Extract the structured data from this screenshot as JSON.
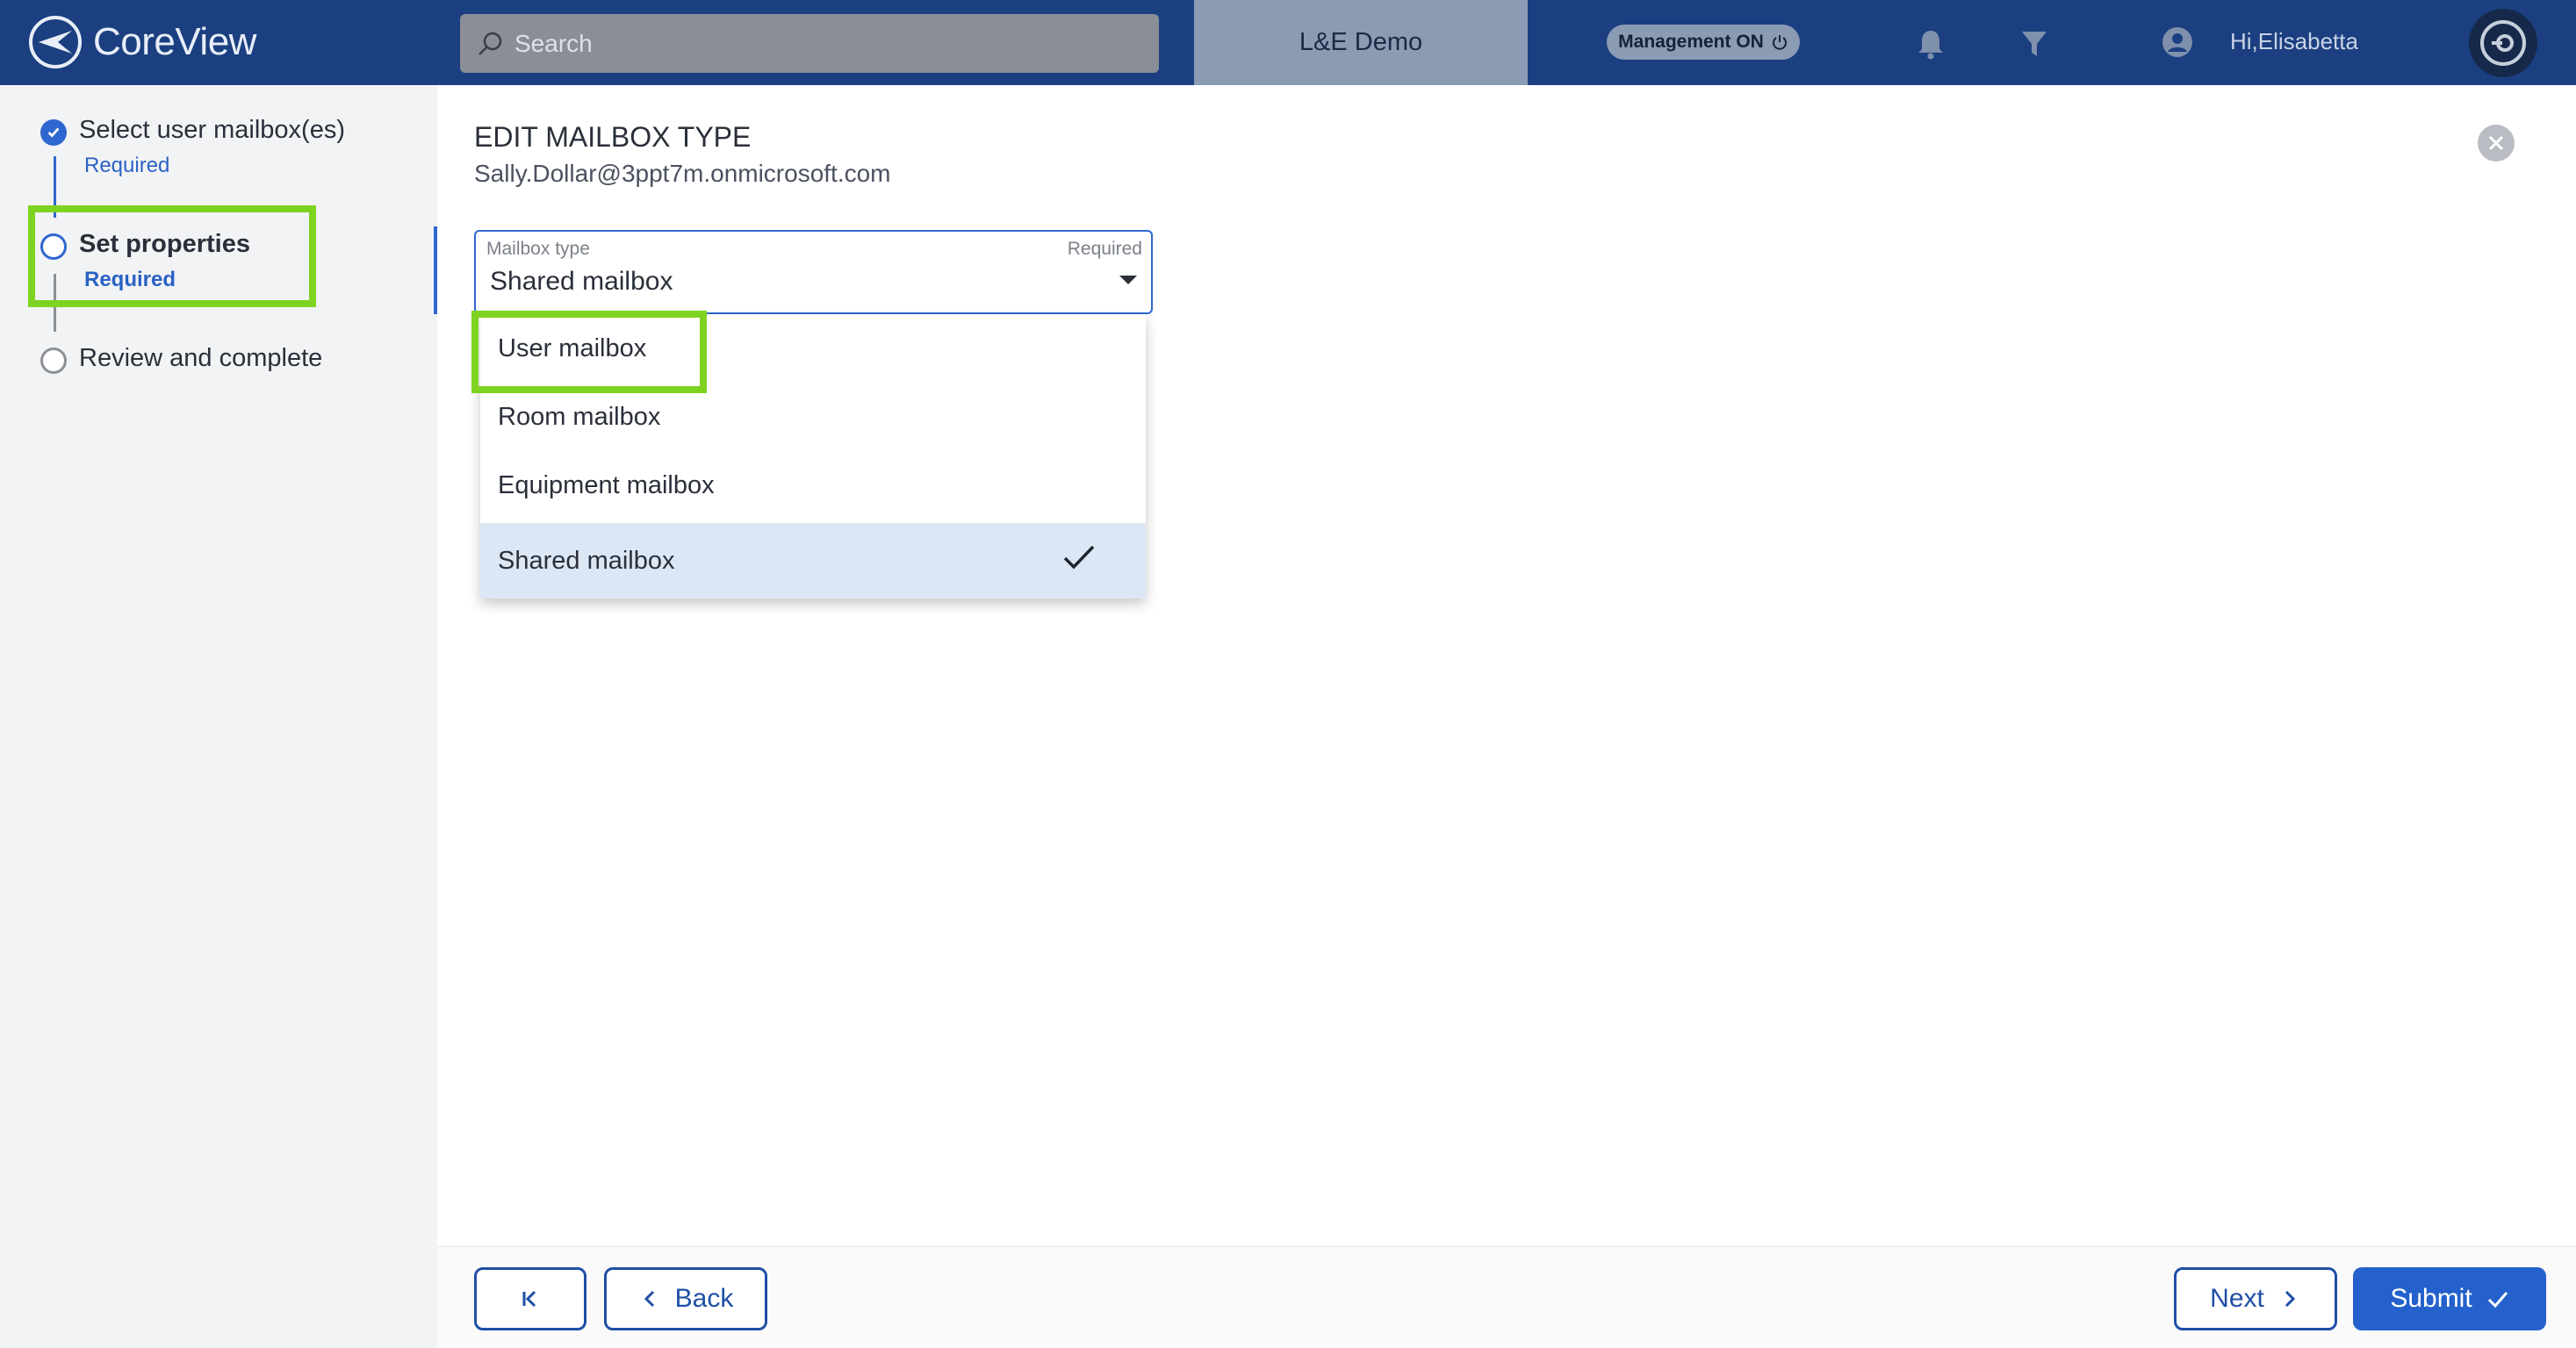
{
  "header": {
    "logo_text": "CoreView",
    "search_placeholder": "Search",
    "tenant": "L&E Demo",
    "management_toggle": "Management ON",
    "greeting": "Hi,Elisabetta"
  },
  "steps": [
    {
      "title": "Select user mailbox(es)",
      "required": "Required",
      "state": "done"
    },
    {
      "title": "Set properties",
      "required": "Required",
      "state": "active"
    },
    {
      "title": "Review and complete",
      "required": "",
      "state": "todo"
    }
  ],
  "main": {
    "heading": "EDIT MAILBOX TYPE",
    "subheading": "Sally.Dollar@3ppt7m.onmicrosoft.com",
    "select": {
      "label": "Mailbox type",
      "required_label": "Required",
      "value": "Shared mailbox"
    },
    "options": [
      {
        "label": "User mailbox",
        "selected": false
      },
      {
        "label": "Room mailbox",
        "selected": false
      },
      {
        "label": "Equipment mailbox",
        "selected": false
      },
      {
        "label": "Shared mailbox",
        "selected": true
      }
    ]
  },
  "footer": {
    "back_label": "Back",
    "next_label": "Next",
    "submit_label": "Submit"
  },
  "colors": {
    "topbar": "#1b3f80",
    "accent": "#2f67d0",
    "highlight": "#7ed321"
  }
}
